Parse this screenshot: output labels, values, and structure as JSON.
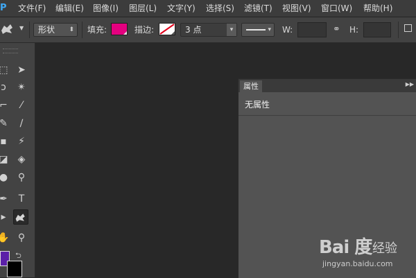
{
  "app": {
    "logo_text": "Ps"
  },
  "menu": [
    "文件(F)",
    "编辑(E)",
    "图像(I)",
    "图层(L)",
    "文字(Y)",
    "选择(S)",
    "滤镜(T)",
    "视图(V)",
    "窗口(W)",
    "帮助(H)"
  ],
  "options": {
    "mode_value": "形状",
    "fill_label": "填充:",
    "fill_color": "#e4007f",
    "stroke_label": "描边:",
    "stroke_width_value": "3 点",
    "w_label": "W:",
    "h_label": "H:",
    "w_value": "",
    "h_value": ""
  },
  "colors": {
    "foreground": "#5b1fa8",
    "background": "#000000"
  },
  "properties_panel": {
    "tab_label": "属性",
    "message": "无属性"
  },
  "watermark": {
    "logo": "Bai 度",
    "brand": "经验",
    "url": "jingyan.baidu.com"
  }
}
